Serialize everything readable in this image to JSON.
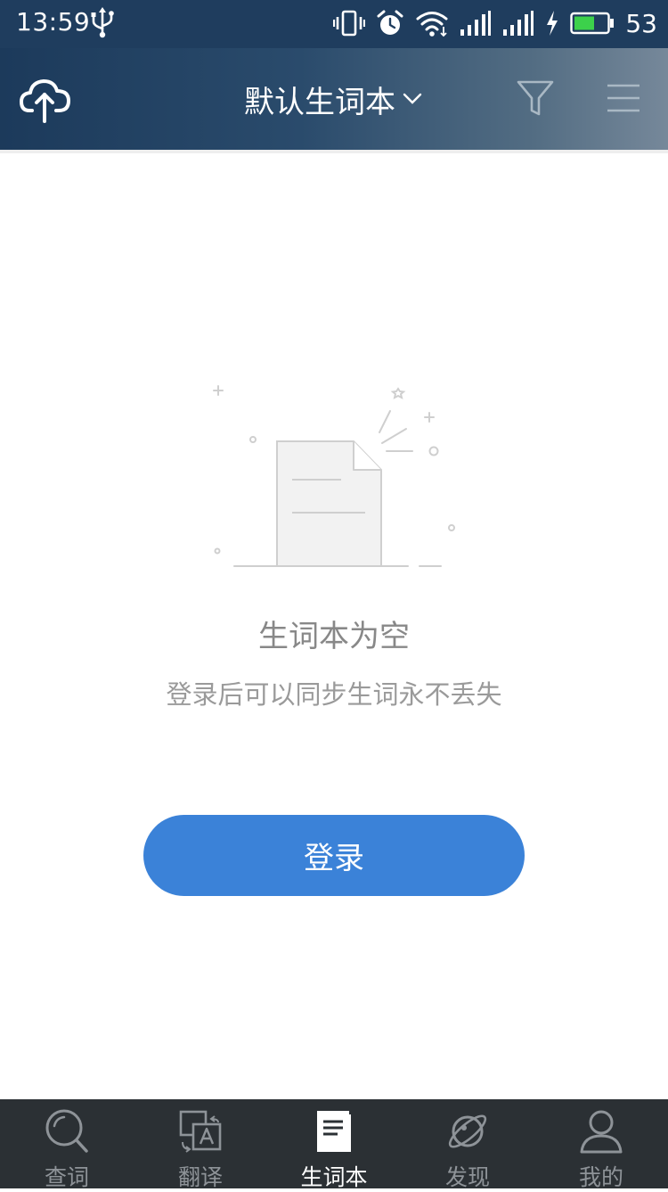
{
  "status_bar": {
    "time": "13:59",
    "battery_percent": "53",
    "icons": [
      "usb-icon",
      "vibrate-icon",
      "alarm-icon",
      "wifi-icon",
      "signal-icon",
      "signal-icon",
      "charging-icon",
      "battery-icon"
    ]
  },
  "app_bar": {
    "title": "默认生词本",
    "icons": [
      "cloud-sync-icon",
      "chevron-down-icon",
      "filter-icon",
      "menu-icon"
    ]
  },
  "empty_state": {
    "title": "生词本为空",
    "subtitle": "登录后可以同步生词永不丢失",
    "login_label": "登录",
    "illustration": "empty-document-icon"
  },
  "bottom_nav": {
    "tabs": [
      {
        "label": "查词",
        "icon": "search-icon",
        "active": false
      },
      {
        "label": "翻译",
        "icon": "translate-icon",
        "active": false
      },
      {
        "label": "生词本",
        "icon": "wordbook-icon",
        "active": true
      },
      {
        "label": "发现",
        "icon": "planet-icon",
        "active": false
      },
      {
        "label": "我的",
        "icon": "profile-icon",
        "active": false
      }
    ]
  },
  "colors": {
    "status_bar_bg": "#1f3d5e",
    "primary_button": "#3b82d8",
    "bottom_nav_bg": "#2b3034"
  }
}
